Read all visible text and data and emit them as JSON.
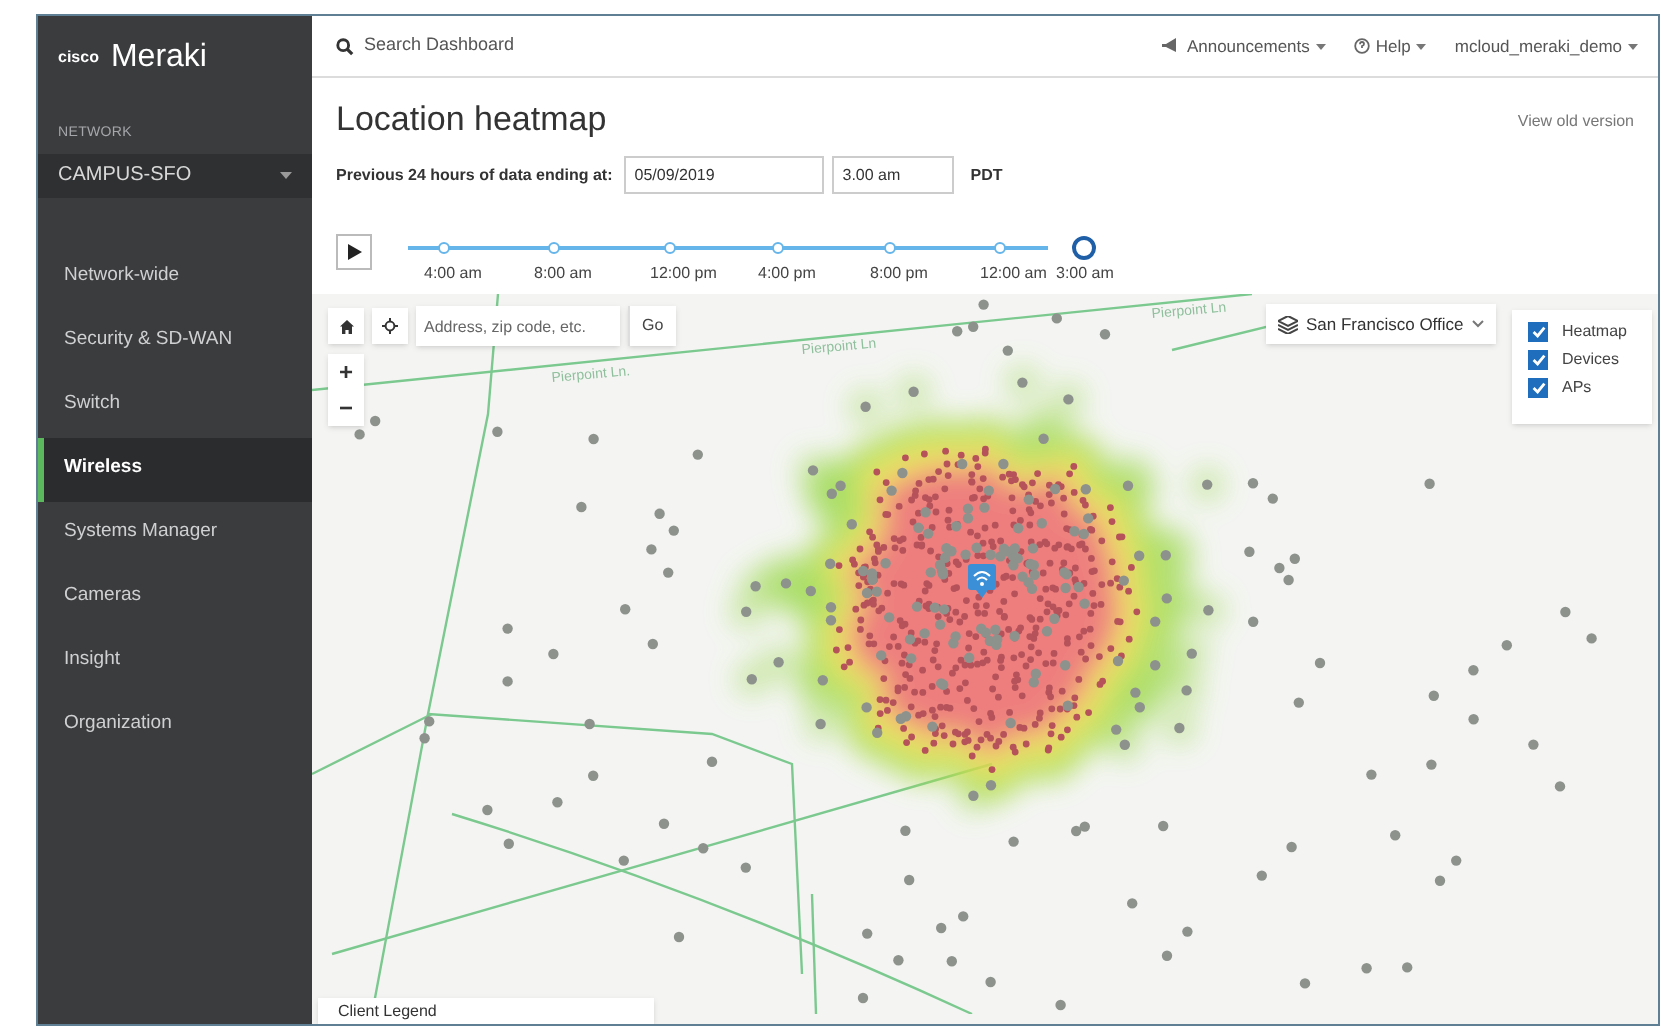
{
  "brand": {
    "logo_text": "cisco",
    "name": "Meraki"
  },
  "sidebar": {
    "section_label": "NETWORK",
    "network": "CAMPUS-SFO",
    "items": [
      {
        "label": "Network-wide",
        "selected": false
      },
      {
        "label": "Security & SD-WAN",
        "selected": false
      },
      {
        "label": "Switch",
        "selected": false
      },
      {
        "label": "Wireless",
        "selected": true
      },
      {
        "label": "Systems Manager",
        "selected": false
      },
      {
        "label": "Cameras",
        "selected": false
      },
      {
        "label": "Insight",
        "selected": false
      },
      {
        "label": "Organization",
        "selected": false
      }
    ]
  },
  "top_bar": {
    "search": {
      "placeholder": "Search Dashboard"
    },
    "menus": [
      {
        "kind": "announcements",
        "label": "Announcements"
      },
      {
        "kind": "help",
        "label": "Help"
      },
      {
        "kind": "user",
        "label": "mcloud_meraki_demo"
      }
    ]
  },
  "page": {
    "title": "Location heatmap",
    "view_old_link": "View old version",
    "range_label": "Previous 24 hours of data ending at:",
    "date": "05/09/2019",
    "time": "3.00 am",
    "timezone": "PDT"
  },
  "timeline": {
    "ticks": [
      {
        "label": "4:00 am",
        "selected": false
      },
      {
        "label": "8:00 am",
        "selected": false
      },
      {
        "label": "12:00 pm",
        "selected": false
      },
      {
        "label": "4:00 pm",
        "selected": false
      },
      {
        "label": "8:00 pm",
        "selected": false
      },
      {
        "label": "12:00 am",
        "selected": false
      },
      {
        "label": "3:00 am",
        "selected": true
      }
    ]
  },
  "map": {
    "address_search": {
      "placeholder": "Address, zip code, etc."
    },
    "go_button": "Go",
    "zoom_in": "+",
    "zoom_out": "−",
    "street_labels": [
      "Pierpoint Ln.",
      "Pierpoint Ln",
      "Pierpoint Ln"
    ],
    "floor_selector": "San Francisco Office",
    "layers": [
      {
        "label": "Heatmap",
        "checked": true
      },
      {
        "label": "Devices",
        "checked": true
      },
      {
        "label": "APs",
        "checked": true
      }
    ],
    "legend_title": "Client Legend"
  }
}
